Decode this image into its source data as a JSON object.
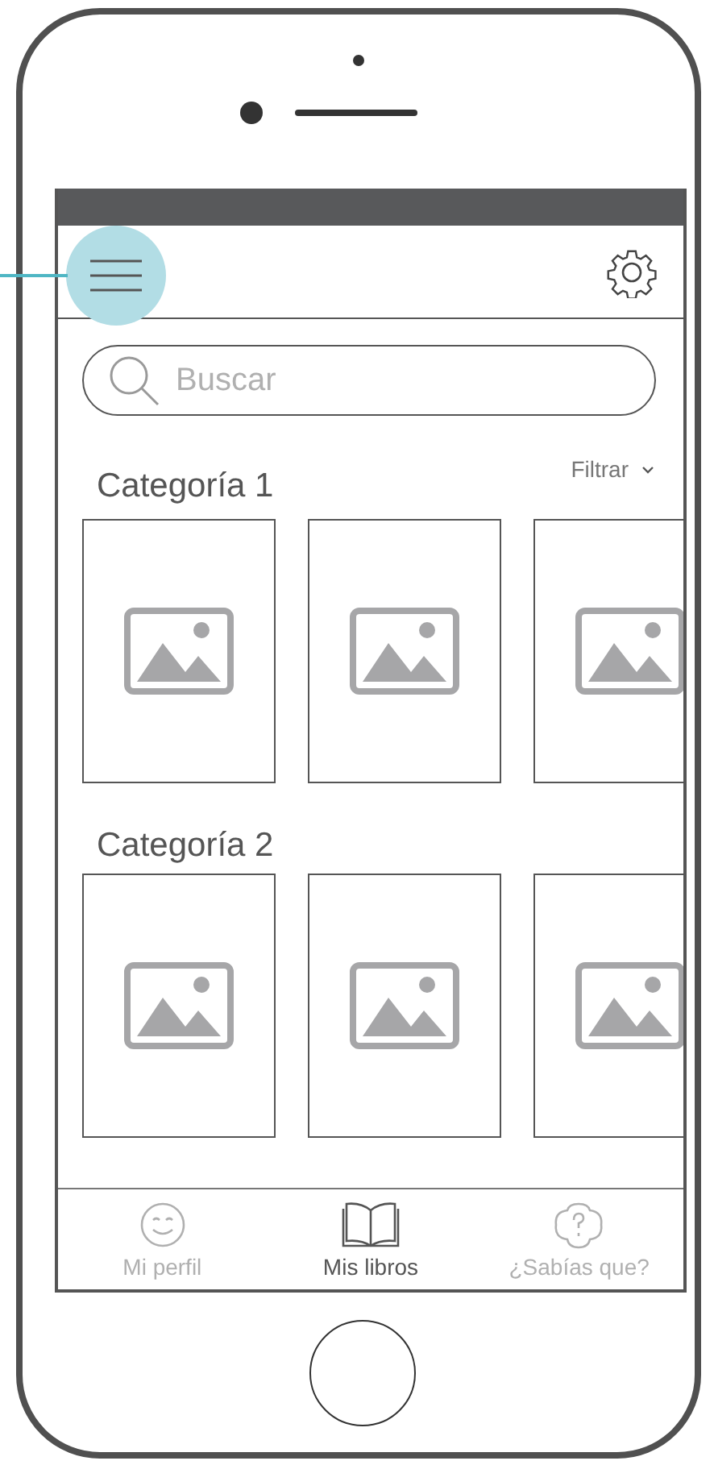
{
  "header": {
    "menu_button": {
      "highlighted": true
    }
  },
  "search": {
    "placeholder": "Buscar"
  },
  "categories": [
    {
      "title": "Categoría 1",
      "filter_label": "Filtrar",
      "cards": [
        {
          "kind": "image-placeholder"
        },
        {
          "kind": "image-placeholder"
        },
        {
          "kind": "image-placeholder"
        }
      ]
    },
    {
      "title": "Categoría 2",
      "cards": [
        {
          "kind": "image-placeholder"
        },
        {
          "kind": "image-placeholder"
        },
        {
          "kind": "image-placeholder"
        }
      ]
    }
  ],
  "tabs": [
    {
      "label": "Mi perfil",
      "kind": "smiley",
      "selected": false
    },
    {
      "label": "Mis libros",
      "kind": "book",
      "selected": true
    },
    {
      "label": "¿Sabías que?",
      "kind": "question",
      "selected": false
    }
  ]
}
